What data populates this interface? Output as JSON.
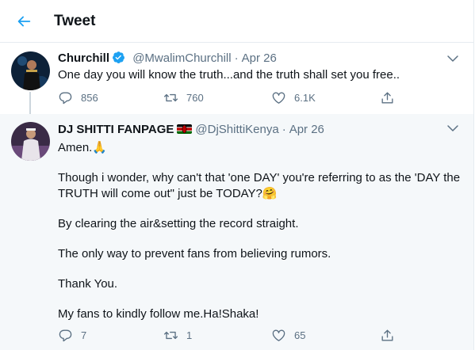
{
  "header": {
    "title": "Tweet",
    "back_icon": "arrow-left-icon",
    "accent": "#1da1f2"
  },
  "tweets": [
    {
      "name": "Churchill",
      "handle": "@MwalimChurchill",
      "separator": "·",
      "date": "Apr 26",
      "verified": true,
      "text": "One day you will know the truth...and the truth shall set you free..",
      "replies": "856",
      "retweets": "760",
      "likes": "6.1K"
    },
    {
      "name": "DJ SHITTI FANPAGE",
      "handle": "@DjShittiKenya",
      "separator": "·",
      "date": "Apr 26",
      "flag": "kenya-flag-emoji",
      "paragraphs": [
        "Amen.🙏",
        "Though i wonder, why can't that 'one DAY' you're referring to as the  'DAY the TRUTH will come out\" just be TODAY?🤗",
        "By clearing the air&setting the record straight.",
        "The only way to prevent fans from believing rumors.",
        "Thank You.",
        "My fans to kindly follow me.Ha!Shaka!"
      ],
      "replies": "7",
      "retweets": "1",
      "likes": "65"
    }
  ]
}
